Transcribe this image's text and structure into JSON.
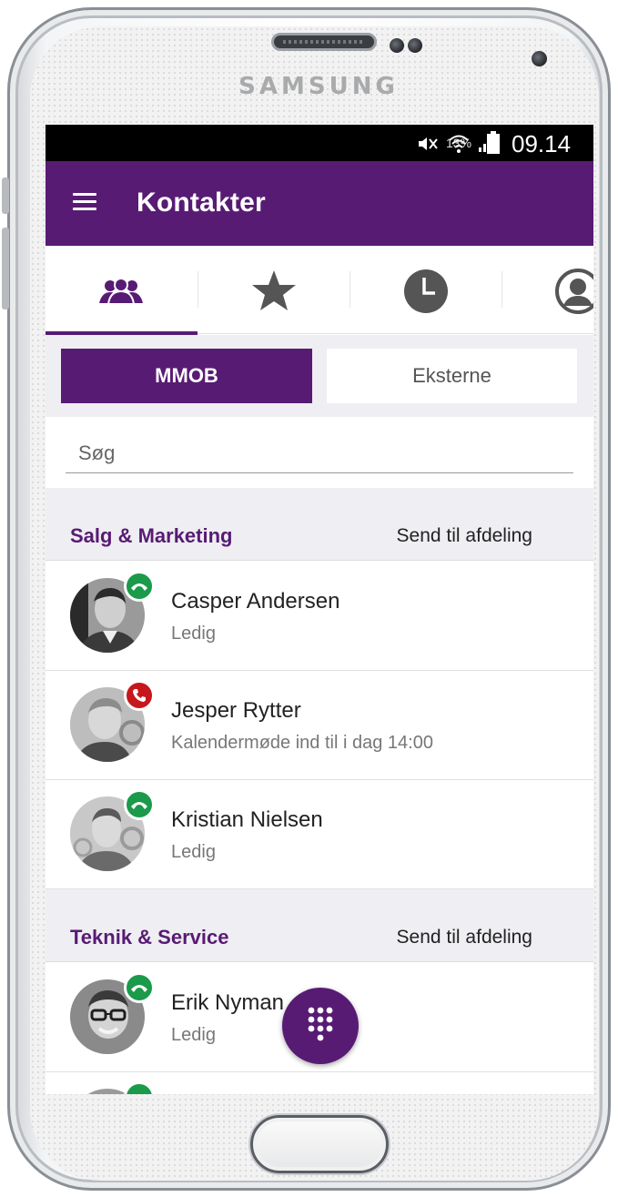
{
  "device": {
    "brand": "SAMSUNG"
  },
  "status_bar": {
    "battery_percent": "13%",
    "time": "09.14"
  },
  "app_bar": {
    "title": "Kontakter",
    "menu_icon": "hamburger-menu-icon"
  },
  "tabs": [
    {
      "icon": "contacts-group-icon",
      "active": true
    },
    {
      "icon": "star-icon",
      "active": false
    },
    {
      "icon": "clock-icon",
      "active": false
    },
    {
      "icon": "profile-icon",
      "active": false
    }
  ],
  "segments": {
    "active": "MMOB",
    "inactive": "Eksterne"
  },
  "search": {
    "placeholder": "Søg"
  },
  "sections": [
    {
      "title": "Salg & Marketing",
      "action": "Send til afdeling",
      "contacts": [
        {
          "name": "Casper Andersen",
          "status": "Ledig",
          "presence": "available"
        },
        {
          "name": "Jesper Rytter",
          "status": "Kalendermøde ind til i dag 14:00",
          "presence": "busy"
        },
        {
          "name": "Kristian Nielsen",
          "status": "Ledig",
          "presence": "available"
        }
      ]
    },
    {
      "title": "Teknik & Service",
      "action": "Send til afdeling",
      "contacts": [
        {
          "name": "Erik Nyman",
          "status": "Ledig",
          "presence": "available"
        }
      ]
    }
  ],
  "colors": {
    "brand_purple": "#581b74",
    "available_green": "#1a9a4a",
    "busy_red": "#c8161d",
    "section_bg": "#efeef2"
  },
  "fab": {
    "icon": "dialpad-icon"
  }
}
